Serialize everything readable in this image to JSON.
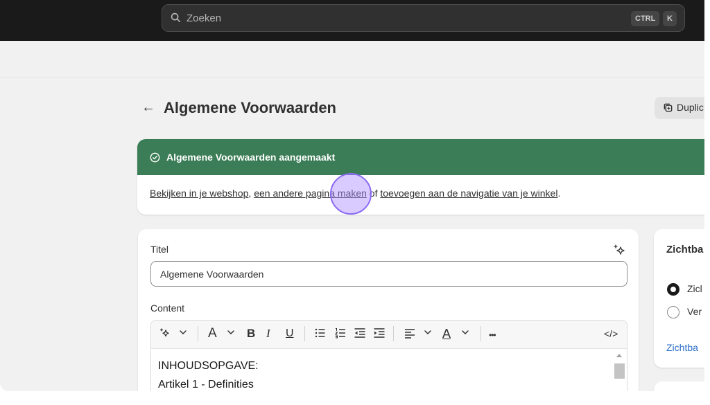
{
  "search": {
    "placeholder": "Zoeken",
    "shortcut_ctrl": "CTRL",
    "shortcut_key": "K"
  },
  "header": {
    "title": "Algemene Voorwaarden",
    "duplicate_label": "Duplic"
  },
  "banner": {
    "title": "Algemene Voorwaarden aangemaakt",
    "link_view": "Bekijken in je webshop",
    "comma": ",",
    "link_new_page": "een andere pagina maken",
    "or": "of",
    "link_navigation": "toevoegen aan de navigatie van je winkel",
    "period": ".",
    "color": "#3b7d56"
  },
  "form": {
    "title_label": "Titel",
    "title_value": "Algemene Voorwaarden",
    "content_label": "Content",
    "content_lines": [
      "INHOUDSOPGAVE:",
      "Artikel 1 - Definities"
    ]
  },
  "toolbar": {
    "bold": "B",
    "italic": "I",
    "underline": "U",
    "font": "A",
    "color": "A",
    "more": "•••",
    "code": "</>"
  },
  "visibility": {
    "title": "Zichtba",
    "option_visible": "Zicl",
    "option_hidden": "Ver",
    "link": "Zichtba",
    "selected": "visible"
  }
}
